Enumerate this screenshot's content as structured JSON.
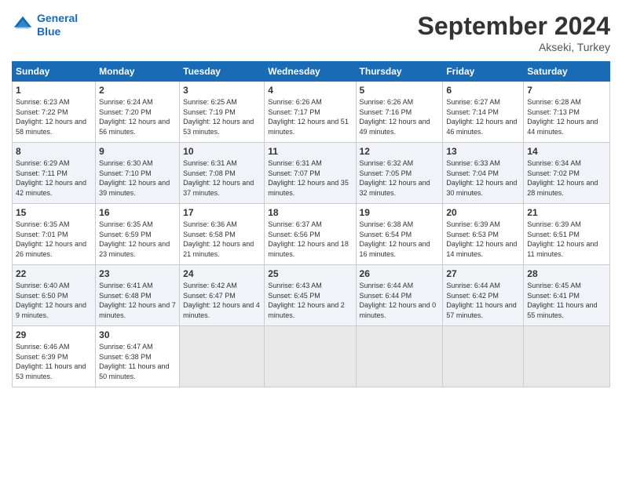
{
  "logo": {
    "line1": "General",
    "line2": "Blue"
  },
  "header": {
    "title": "September 2024",
    "subtitle": "Akseki, Turkey"
  },
  "weekdays": [
    "Sunday",
    "Monday",
    "Tuesday",
    "Wednesday",
    "Thursday",
    "Friday",
    "Saturday"
  ],
  "weeks": [
    [
      {
        "day": "1",
        "sunrise": "6:23 AM",
        "sunset": "7:22 PM",
        "daylight": "12 hours and 58 minutes."
      },
      {
        "day": "2",
        "sunrise": "6:24 AM",
        "sunset": "7:20 PM",
        "daylight": "12 hours and 56 minutes."
      },
      {
        "day": "3",
        "sunrise": "6:25 AM",
        "sunset": "7:19 PM",
        "daylight": "12 hours and 53 minutes."
      },
      {
        "day": "4",
        "sunrise": "6:26 AM",
        "sunset": "7:17 PM",
        "daylight": "12 hours and 51 minutes."
      },
      {
        "day": "5",
        "sunrise": "6:26 AM",
        "sunset": "7:16 PM",
        "daylight": "12 hours and 49 minutes."
      },
      {
        "day": "6",
        "sunrise": "6:27 AM",
        "sunset": "7:14 PM",
        "daylight": "12 hours and 46 minutes."
      },
      {
        "day": "7",
        "sunrise": "6:28 AM",
        "sunset": "7:13 PM",
        "daylight": "12 hours and 44 minutes."
      }
    ],
    [
      {
        "day": "8",
        "sunrise": "6:29 AM",
        "sunset": "7:11 PM",
        "daylight": "12 hours and 42 minutes."
      },
      {
        "day": "9",
        "sunrise": "6:30 AM",
        "sunset": "7:10 PM",
        "daylight": "12 hours and 39 minutes."
      },
      {
        "day": "10",
        "sunrise": "6:31 AM",
        "sunset": "7:08 PM",
        "daylight": "12 hours and 37 minutes."
      },
      {
        "day": "11",
        "sunrise": "6:31 AM",
        "sunset": "7:07 PM",
        "daylight": "12 hours and 35 minutes."
      },
      {
        "day": "12",
        "sunrise": "6:32 AM",
        "sunset": "7:05 PM",
        "daylight": "12 hours and 32 minutes."
      },
      {
        "day": "13",
        "sunrise": "6:33 AM",
        "sunset": "7:04 PM",
        "daylight": "12 hours and 30 minutes."
      },
      {
        "day": "14",
        "sunrise": "6:34 AM",
        "sunset": "7:02 PM",
        "daylight": "12 hours and 28 minutes."
      }
    ],
    [
      {
        "day": "15",
        "sunrise": "6:35 AM",
        "sunset": "7:01 PM",
        "daylight": "12 hours and 26 minutes."
      },
      {
        "day": "16",
        "sunrise": "6:35 AM",
        "sunset": "6:59 PM",
        "daylight": "12 hours and 23 minutes."
      },
      {
        "day": "17",
        "sunrise": "6:36 AM",
        "sunset": "6:58 PM",
        "daylight": "12 hours and 21 minutes."
      },
      {
        "day": "18",
        "sunrise": "6:37 AM",
        "sunset": "6:56 PM",
        "daylight": "12 hours and 18 minutes."
      },
      {
        "day": "19",
        "sunrise": "6:38 AM",
        "sunset": "6:54 PM",
        "daylight": "12 hours and 16 minutes."
      },
      {
        "day": "20",
        "sunrise": "6:39 AM",
        "sunset": "6:53 PM",
        "daylight": "12 hours and 14 minutes."
      },
      {
        "day": "21",
        "sunrise": "6:39 AM",
        "sunset": "6:51 PM",
        "daylight": "12 hours and 11 minutes."
      }
    ],
    [
      {
        "day": "22",
        "sunrise": "6:40 AM",
        "sunset": "6:50 PM",
        "daylight": "12 hours and 9 minutes."
      },
      {
        "day": "23",
        "sunrise": "6:41 AM",
        "sunset": "6:48 PM",
        "daylight": "12 hours and 7 minutes."
      },
      {
        "day": "24",
        "sunrise": "6:42 AM",
        "sunset": "6:47 PM",
        "daylight": "12 hours and 4 minutes."
      },
      {
        "day": "25",
        "sunrise": "6:43 AM",
        "sunset": "6:45 PM",
        "daylight": "12 hours and 2 minutes."
      },
      {
        "day": "26",
        "sunrise": "6:44 AM",
        "sunset": "6:44 PM",
        "daylight": "12 hours and 0 minutes."
      },
      {
        "day": "27",
        "sunrise": "6:44 AM",
        "sunset": "6:42 PM",
        "daylight": "11 hours and 57 minutes."
      },
      {
        "day": "28",
        "sunrise": "6:45 AM",
        "sunset": "6:41 PM",
        "daylight": "11 hours and 55 minutes."
      }
    ],
    [
      {
        "day": "29",
        "sunrise": "6:46 AM",
        "sunset": "6:39 PM",
        "daylight": "11 hours and 53 minutes."
      },
      {
        "day": "30",
        "sunrise": "6:47 AM",
        "sunset": "6:38 PM",
        "daylight": "11 hours and 50 minutes."
      },
      null,
      null,
      null,
      null,
      null
    ]
  ]
}
